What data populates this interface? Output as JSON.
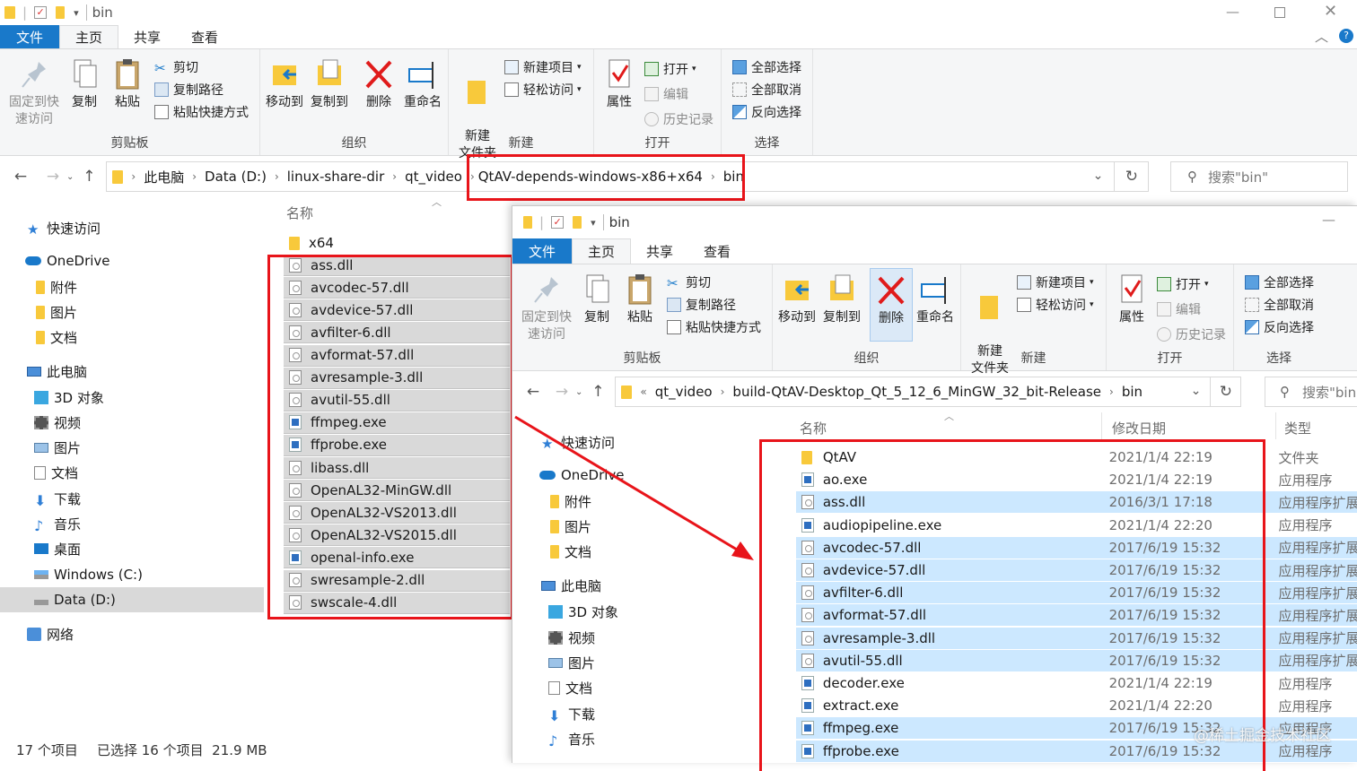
{
  "back_window": {
    "title": "bin",
    "tabs": [
      "文件",
      "主页",
      "共享",
      "查看"
    ],
    "ribbon": {
      "clipboard": {
        "label": "剪贴板",
        "pin": "固定到快速访问",
        "copy": "复制",
        "paste": "粘贴",
        "cut": "剪切",
        "copy_path": "复制路径",
        "paste_shortcut": "粘贴快捷方式"
      },
      "organize": {
        "label": "组织",
        "move_to": "移动到",
        "copy_to": "复制到",
        "delete": "删除",
        "rename": "重命名"
      },
      "new": {
        "label": "新建",
        "new_folder": "新建\n文件夹",
        "new_item": "新建项目",
        "easy_access": "轻松访问"
      },
      "open": {
        "label": "打开",
        "properties": "属性",
        "open": "打开",
        "edit": "编辑",
        "history": "历史记录"
      },
      "select": {
        "label": "选择",
        "select_all": "全部选择",
        "select_none": "全部取消",
        "invert": "反向选择"
      }
    },
    "address": {
      "crumbs": [
        "此电脑",
        "Data (D:)",
        "linux-share-dir",
        "qt_video",
        "QtAV-depends-windows-x86+x64",
        "bin"
      ]
    },
    "search_placeholder": "搜索\"bin\"",
    "column_name": "名称",
    "nav": [
      {
        "label": "快速访问",
        "icon": "star-icon"
      },
      {
        "label": "OneDrive",
        "icon": "cloud-icon"
      },
      {
        "label": "附件",
        "icon": "folder-icon"
      },
      {
        "label": "图片",
        "icon": "folder-icon"
      },
      {
        "label": "文档",
        "icon": "folder-icon"
      },
      {
        "label": "此电脑",
        "icon": "computer-icon"
      },
      {
        "label": "3D 对象",
        "icon": "cube-icon"
      },
      {
        "label": "视频",
        "icon": "video-icon"
      },
      {
        "label": "图片",
        "icon": "picture-icon"
      },
      {
        "label": "文档",
        "icon": "document-icon"
      },
      {
        "label": "下载",
        "icon": "download-icon"
      },
      {
        "label": "音乐",
        "icon": "music-icon"
      },
      {
        "label": "桌面",
        "icon": "desktop-icon"
      },
      {
        "label": "Windows (C:)",
        "icon": "drive-icon"
      },
      {
        "label": "Data (D:)",
        "icon": "drive-icon"
      },
      {
        "label": "网络",
        "icon": "network-icon"
      }
    ],
    "files": [
      {
        "name": "x64",
        "type": "folder",
        "selected": false
      },
      {
        "name": "ass.dll",
        "type": "dll",
        "selected": true
      },
      {
        "name": "avcodec-57.dll",
        "type": "dll",
        "selected": true
      },
      {
        "name": "avdevice-57.dll",
        "type": "dll",
        "selected": true
      },
      {
        "name": "avfilter-6.dll",
        "type": "dll",
        "selected": true
      },
      {
        "name": "avformat-57.dll",
        "type": "dll",
        "selected": true
      },
      {
        "name": "avresample-3.dll",
        "type": "dll",
        "selected": true
      },
      {
        "name": "avutil-55.dll",
        "type": "dll",
        "selected": true
      },
      {
        "name": "ffmpeg.exe",
        "type": "exe",
        "selected": true
      },
      {
        "name": "ffprobe.exe",
        "type": "exe",
        "selected": true
      },
      {
        "name": "libass.dll",
        "type": "dll",
        "selected": true
      },
      {
        "name": "OpenAL32-MinGW.dll",
        "type": "dll",
        "selected": true
      },
      {
        "name": "OpenAL32-VS2013.dll",
        "type": "dll",
        "selected": true
      },
      {
        "name": "OpenAL32-VS2015.dll",
        "type": "dll",
        "selected": true
      },
      {
        "name": "openal-info.exe",
        "type": "exe",
        "selected": true
      },
      {
        "name": "swresample-2.dll",
        "type": "dll",
        "selected": true
      },
      {
        "name": "swscale-4.dll",
        "type": "dll",
        "selected": true
      }
    ],
    "status": {
      "count": "17 个项目",
      "selection": "已选择 16 个项目  21.9 MB"
    }
  },
  "front_window": {
    "title": "bin",
    "tabs": [
      "文件",
      "主页",
      "共享",
      "查看"
    ],
    "address": {
      "crumbs": [
        "qt_video",
        "build-QtAV-Desktop_Qt_5_12_6_MinGW_32_bit-Release",
        "bin"
      ]
    },
    "search_placeholder": "搜索\"bin",
    "columns": {
      "name": "名称",
      "date": "修改日期",
      "type": "类型"
    },
    "nav": [
      {
        "label": "快速访问",
        "icon": "star-icon"
      },
      {
        "label": "OneDrive",
        "icon": "cloud-icon"
      },
      {
        "label": "附件",
        "icon": "folder-icon"
      },
      {
        "label": "图片",
        "icon": "folder-icon"
      },
      {
        "label": "文档",
        "icon": "folder-icon"
      },
      {
        "label": "此电脑",
        "icon": "computer-icon"
      },
      {
        "label": "3D 对象",
        "icon": "cube-icon"
      },
      {
        "label": "视频",
        "icon": "video-icon"
      },
      {
        "label": "图片",
        "icon": "picture-icon"
      },
      {
        "label": "文档",
        "icon": "document-icon"
      },
      {
        "label": "下载",
        "icon": "download-icon"
      },
      {
        "label": "音乐",
        "icon": "music-icon"
      }
    ],
    "files": [
      {
        "name": "QtAV",
        "date": "2021/1/4 22:19",
        "type": "文件夹",
        "kind": "folder",
        "selected": false
      },
      {
        "name": "ao.exe",
        "date": "2021/1/4 22:19",
        "type": "应用程序",
        "kind": "exe",
        "selected": false
      },
      {
        "name": "ass.dll",
        "date": "2016/3/1 17:18",
        "type": "应用程序扩展",
        "kind": "dll",
        "selected": true
      },
      {
        "name": "audiopipeline.exe",
        "date": "2021/1/4 22:20",
        "type": "应用程序",
        "kind": "exe",
        "selected": false
      },
      {
        "name": "avcodec-57.dll",
        "date": "2017/6/19 15:32",
        "type": "应用程序扩展",
        "kind": "dll",
        "selected": true
      },
      {
        "name": "avdevice-57.dll",
        "date": "2017/6/19 15:32",
        "type": "应用程序扩展",
        "kind": "dll",
        "selected": true
      },
      {
        "name": "avfilter-6.dll",
        "date": "2017/6/19 15:32",
        "type": "应用程序扩展",
        "kind": "dll",
        "selected": true
      },
      {
        "name": "avformat-57.dll",
        "date": "2017/6/19 15:32",
        "type": "应用程序扩展",
        "kind": "dll",
        "selected": true
      },
      {
        "name": "avresample-3.dll",
        "date": "2017/6/19 15:32",
        "type": "应用程序扩展",
        "kind": "dll",
        "selected": true
      },
      {
        "name": "avutil-55.dll",
        "date": "2017/6/19 15:32",
        "type": "应用程序扩展",
        "kind": "dll",
        "selected": true
      },
      {
        "name": "decoder.exe",
        "date": "2021/1/4 22:19",
        "type": "应用程序",
        "kind": "exe",
        "selected": false
      },
      {
        "name": "extract.exe",
        "date": "2021/1/4 22:20",
        "type": "应用程序",
        "kind": "exe",
        "selected": false
      },
      {
        "name": "ffmpeg.exe",
        "date": "2017/6/19 15:32",
        "type": "应用程序",
        "kind": "exe",
        "selected": true
      },
      {
        "name": "ffprobe.exe",
        "date": "2017/6/19 15:32",
        "type": "应用程序",
        "kind": "exe",
        "selected": true
      }
    ]
  },
  "watermark": "@稀土掘金技术社区",
  "colors": {
    "accent": "#1979ca",
    "highlight": "#cce8ff",
    "selected_gray": "#d9d9d9",
    "annotation": "#e8141a",
    "folder": "#f8c93b"
  }
}
